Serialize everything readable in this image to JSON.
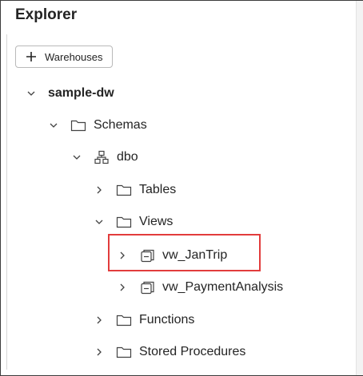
{
  "panel": {
    "title": "Explorer"
  },
  "toolbar": {
    "add_button_label": "Warehouses"
  },
  "tree": {
    "warehouse": {
      "label": "sample-dw"
    },
    "schemas": {
      "label": "Schemas"
    },
    "schema": {
      "label": "dbo"
    },
    "tables": {
      "label": "Tables"
    },
    "views": {
      "label": "Views"
    },
    "view_items": [
      {
        "label": "vw_JanTrip"
      },
      {
        "label": "vw_PaymentAnalysis"
      }
    ],
    "functions": {
      "label": "Functions"
    },
    "stored_procedures": {
      "label": "Stored Procedures"
    }
  },
  "accent": {
    "highlight_border": "#e23c3c"
  }
}
